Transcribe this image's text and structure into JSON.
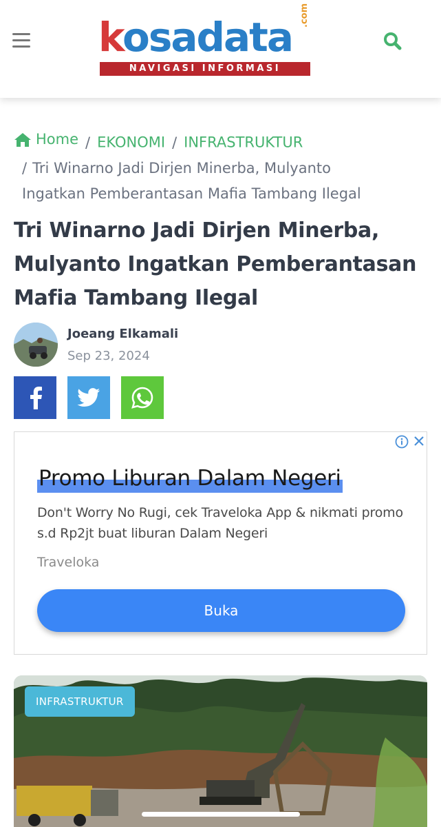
{
  "header": {
    "logo_word": "kosadata",
    "logo_k": "k",
    "logo_rest": "osadata",
    "logo_com": ".com",
    "logo_tagline": "NAVIGASI INFORMASI",
    "menu_icon": "hamburger-icon",
    "search_icon": "search-icon"
  },
  "breadcrumb": {
    "home": "Home",
    "category": "EKONOMI",
    "subcategory": "INFRASTRUKTUR",
    "current_line1": "Tri Winarno Jadi Dirjen Minerba, Mulyanto",
    "current_line2": "Ingatkan Pemberantasan Mafia Tambang Ilegal",
    "separator": "/"
  },
  "article": {
    "title": "Tri Winarno Jadi Dirjen Minerba, Mulyanto Ingatkan Pemberantasan Mafia Tambang Ilegal",
    "author": "Joeang Elkamali",
    "date": "Sep 23, 2024"
  },
  "share": {
    "facebook_icon": "facebook-icon",
    "twitter_icon": "twitter-icon",
    "whatsapp_icon": "whatsapp-icon"
  },
  "ad": {
    "headline": "Promo Liburan Dalam Negeri",
    "body": "Don't Worry No Rugi, cek Traveloka App & nikmati promo s.d Rp2jt buat liburan Dalam Negeri",
    "advertiser": "Traveloka",
    "cta": "Buka"
  },
  "featured": {
    "category_badge": "INFRASTRUKTUR"
  },
  "colors": {
    "accent_green": "#46b36f",
    "facebook": "#2d56b6",
    "twitter": "#4aa3e4",
    "whatsapp": "#5ec83c",
    "ad_cta": "#3a86f6",
    "badge": "#4bb8d8"
  }
}
